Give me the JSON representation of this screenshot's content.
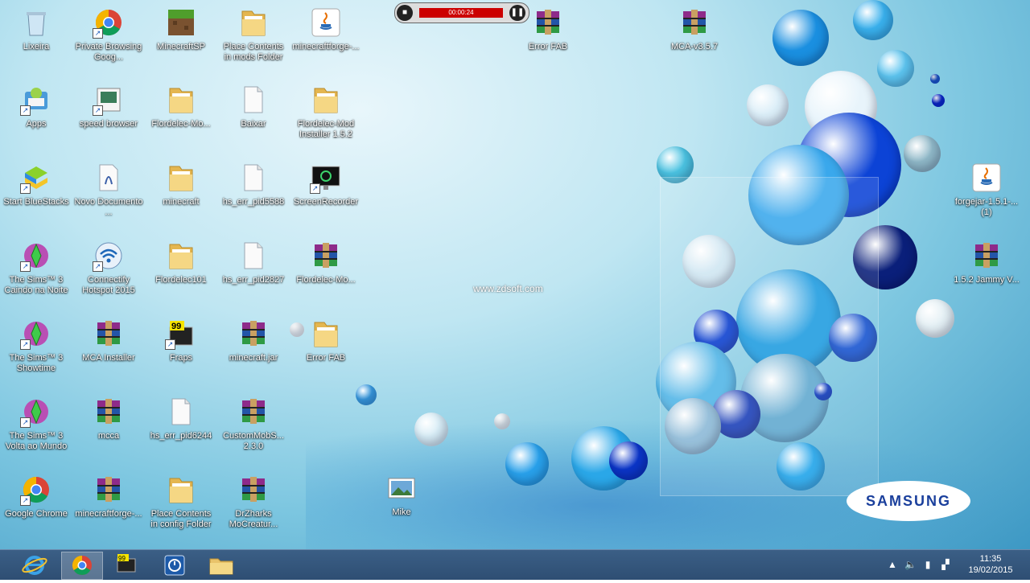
{
  "desktop": {
    "icons": [
      {
        "label": "Lixeira",
        "icon": "recycle-bin-icon",
        "shortcut": false
      },
      {
        "label": "Private Browsing Goog...",
        "icon": "chrome-icon",
        "shortcut": true
      },
      {
        "label": "MinecraftSP",
        "icon": "minecraft-icon",
        "shortcut": false
      },
      {
        "label": "Place Contents in mods Folder",
        "icon": "folder-icon",
        "shortcut": false
      },
      {
        "label": "minecraftforge-...",
        "icon": "java-icon",
        "shortcut": false
      },
      {
        "label": "Apps",
        "icon": "bluestacks-apps-icon",
        "shortcut": true
      },
      {
        "label": "speed browser",
        "icon": "app-icon",
        "shortcut": true
      },
      {
        "label": "Flordelec-Mo...",
        "icon": "folder-icon",
        "shortcut": false
      },
      {
        "label": "Baixar",
        "icon": "file-icon",
        "shortcut": false
      },
      {
        "label": "Flordelec-Mod Installer 1.5.2",
        "icon": "folder-icon",
        "shortcut": false
      },
      {
        "label": "Start BlueStacks",
        "icon": "bluestacks-icon",
        "shortcut": true
      },
      {
        "label": "Novo Documento ...",
        "icon": "document-icon",
        "shortcut": false
      },
      {
        "label": "minecraft",
        "icon": "folder-icon",
        "shortcut": false
      },
      {
        "label": "hs_err_pid5588",
        "icon": "file-icon",
        "shortcut": false
      },
      {
        "label": "ScreenRecorder",
        "icon": "screen-recorder-icon",
        "shortcut": true
      },
      {
        "label": "The Sims™ 3 Caindo na Noite",
        "icon": "sims-icon",
        "shortcut": true
      },
      {
        "label": "Connectify Hotspot 2015",
        "icon": "wifi-icon",
        "shortcut": true
      },
      {
        "label": "Flordelec101",
        "icon": "folder-icon",
        "shortcut": false
      },
      {
        "label": "hs_err_pid2827",
        "icon": "file-icon",
        "shortcut": false
      },
      {
        "label": "Flordelec-Mo...",
        "icon": "winrar-icon",
        "shortcut": false
      },
      {
        "label": "The Sims™ 3 Showtime",
        "icon": "sims-icon",
        "shortcut": true
      },
      {
        "label": "MCA Installer",
        "icon": "winrar-icon",
        "shortcut": false
      },
      {
        "label": "Fraps",
        "icon": "fraps-icon",
        "shortcut": true
      },
      {
        "label": "minecraft.jar",
        "icon": "winrar-icon",
        "shortcut": false
      },
      {
        "label": "Error FAB",
        "icon": "folder-icon",
        "shortcut": false
      },
      {
        "label": "The Sims™ 3 Volta ao Mundo",
        "icon": "sims-icon",
        "shortcut": true
      },
      {
        "label": "mcca",
        "icon": "winrar-icon",
        "shortcut": false
      },
      {
        "label": "hs_err_pid6244",
        "icon": "file-icon",
        "shortcut": false
      },
      {
        "label": "CustomMobS... 2.3.0",
        "icon": "winrar-icon",
        "shortcut": false
      },
      {
        "label": "Google Chrome",
        "icon": "chrome-icon",
        "shortcut": true
      },
      {
        "label": "minecraftforge-...",
        "icon": "winrar-icon",
        "shortcut": false
      },
      {
        "label": "Place Contents in config Folder",
        "icon": "folder-icon",
        "shortcut": false
      },
      {
        "label": "DrZharks MoCreatur...",
        "icon": "winrar-icon",
        "shortcut": false
      },
      {
        "label": "Mike",
        "icon": "image-icon",
        "shortcut": false
      },
      {
        "label": "Error FAB",
        "icon": "winrar-icon",
        "shortcut": false
      },
      {
        "label": "MCA-v3.5.7",
        "icon": "winrar-icon",
        "shortcut": false
      },
      {
        "label": "forgejar-1.5.1-...(1)",
        "icon": "java-icon",
        "shortcut": false
      },
      {
        "label": "1.5.2 Jammy V...",
        "icon": "winrar-icon",
        "shortcut": false
      }
    ],
    "watermark": "www.zdsoft.com",
    "brand": "SAMSUNG",
    "recorder_text": "00:00:24"
  },
  "taskbar": {
    "apps": [
      {
        "name": "internet-explorer",
        "icon": "ie-icon",
        "active": false
      },
      {
        "name": "google-chrome",
        "icon": "chrome-icon",
        "active": true
      },
      {
        "name": "fraps",
        "icon": "fraps-icon",
        "active": false
      },
      {
        "name": "time-app",
        "icon": "clock-app-icon",
        "active": false
      },
      {
        "name": "file-explorer",
        "icon": "folder-icon",
        "active": false
      }
    ],
    "clock": {
      "time": "11:35",
      "date": "19/02/2015"
    }
  }
}
